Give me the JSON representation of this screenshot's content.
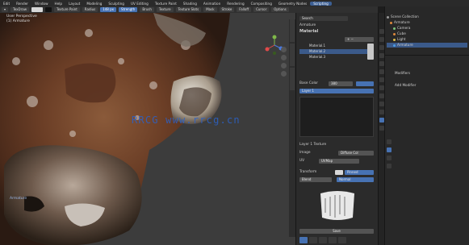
{
  "menu": {
    "items": [
      "Edit",
      "Render",
      "Window",
      "Help",
      "Layout",
      "Modeling",
      "Sculpting",
      "UV Editing",
      "Texture Paint",
      "Shading",
      "Animation",
      "Rendering",
      "Compositing",
      "Geometry Nodes",
      "Scripting"
    ],
    "active_index": 14
  },
  "header": {
    "brush_name": "TexDraw",
    "mode": "Texture Paint",
    "view": "View",
    "radius_label": "Radius",
    "radius_value": "148 px",
    "strength_label": "Strength",
    "brush": "Brush",
    "texture": "Texture",
    "texture_slots": "Texture Slots",
    "mask": "Mask",
    "stroke": "Stroke",
    "falloff": "Falloff",
    "cursor": "Cursor",
    "options": "Options"
  },
  "viewport": {
    "overlay_line1": "User Perspective",
    "overlay_line2": "(1) Armature",
    "watermark": "RRCG www.rrcg.cn",
    "corner_label": "Armature"
  },
  "properties": {
    "search_placeholder": "Search",
    "breadcrumb": "Armature",
    "section_material": "Material",
    "slots": [
      "Material.1",
      "Material.2",
      "Material.3"
    ],
    "selected_slot_index": 1,
    "base_color_label": "Base Color",
    "base_color_value": "380",
    "layer_label": "Layer 1",
    "layer_value": "",
    "texture_section": "Layer 1 Texture",
    "image_label": "Image",
    "image_value": "Diffuse Col",
    "uv_label": "UV",
    "uv_value": "UVMap",
    "transform_section": "Transform",
    "mapping_label": "Mapping",
    "mapping_value": "Pinned",
    "blend_label": "Blend",
    "blend_value": "Normal",
    "save_label": "Save"
  },
  "outliner": {
    "title": "Scene Collection",
    "items": [
      {
        "label": "Scene Collection",
        "indent": 0,
        "color": "#9a9a9a"
      },
      {
        "label": "Armature",
        "indent": 1,
        "color": "#e08a3c"
      },
      {
        "label": "Camera",
        "indent": 2,
        "color": "#7cc47c"
      },
      {
        "label": "Cube",
        "indent": 2,
        "color": "#e08a3c"
      },
      {
        "label": "Light",
        "indent": 2,
        "color": "#e0c04c"
      },
      {
        "label": "Armature",
        "indent": 2,
        "color": "#4c9ae0"
      }
    ],
    "selected_index": 5,
    "section2": "Modifiers",
    "section3": "Add Modifier"
  },
  "colors": {
    "accent": "#4772b3",
    "selection": "#3b5a8a",
    "panel_bg": "#2b2b2b",
    "viewport_bg": "#3a3a3a"
  }
}
